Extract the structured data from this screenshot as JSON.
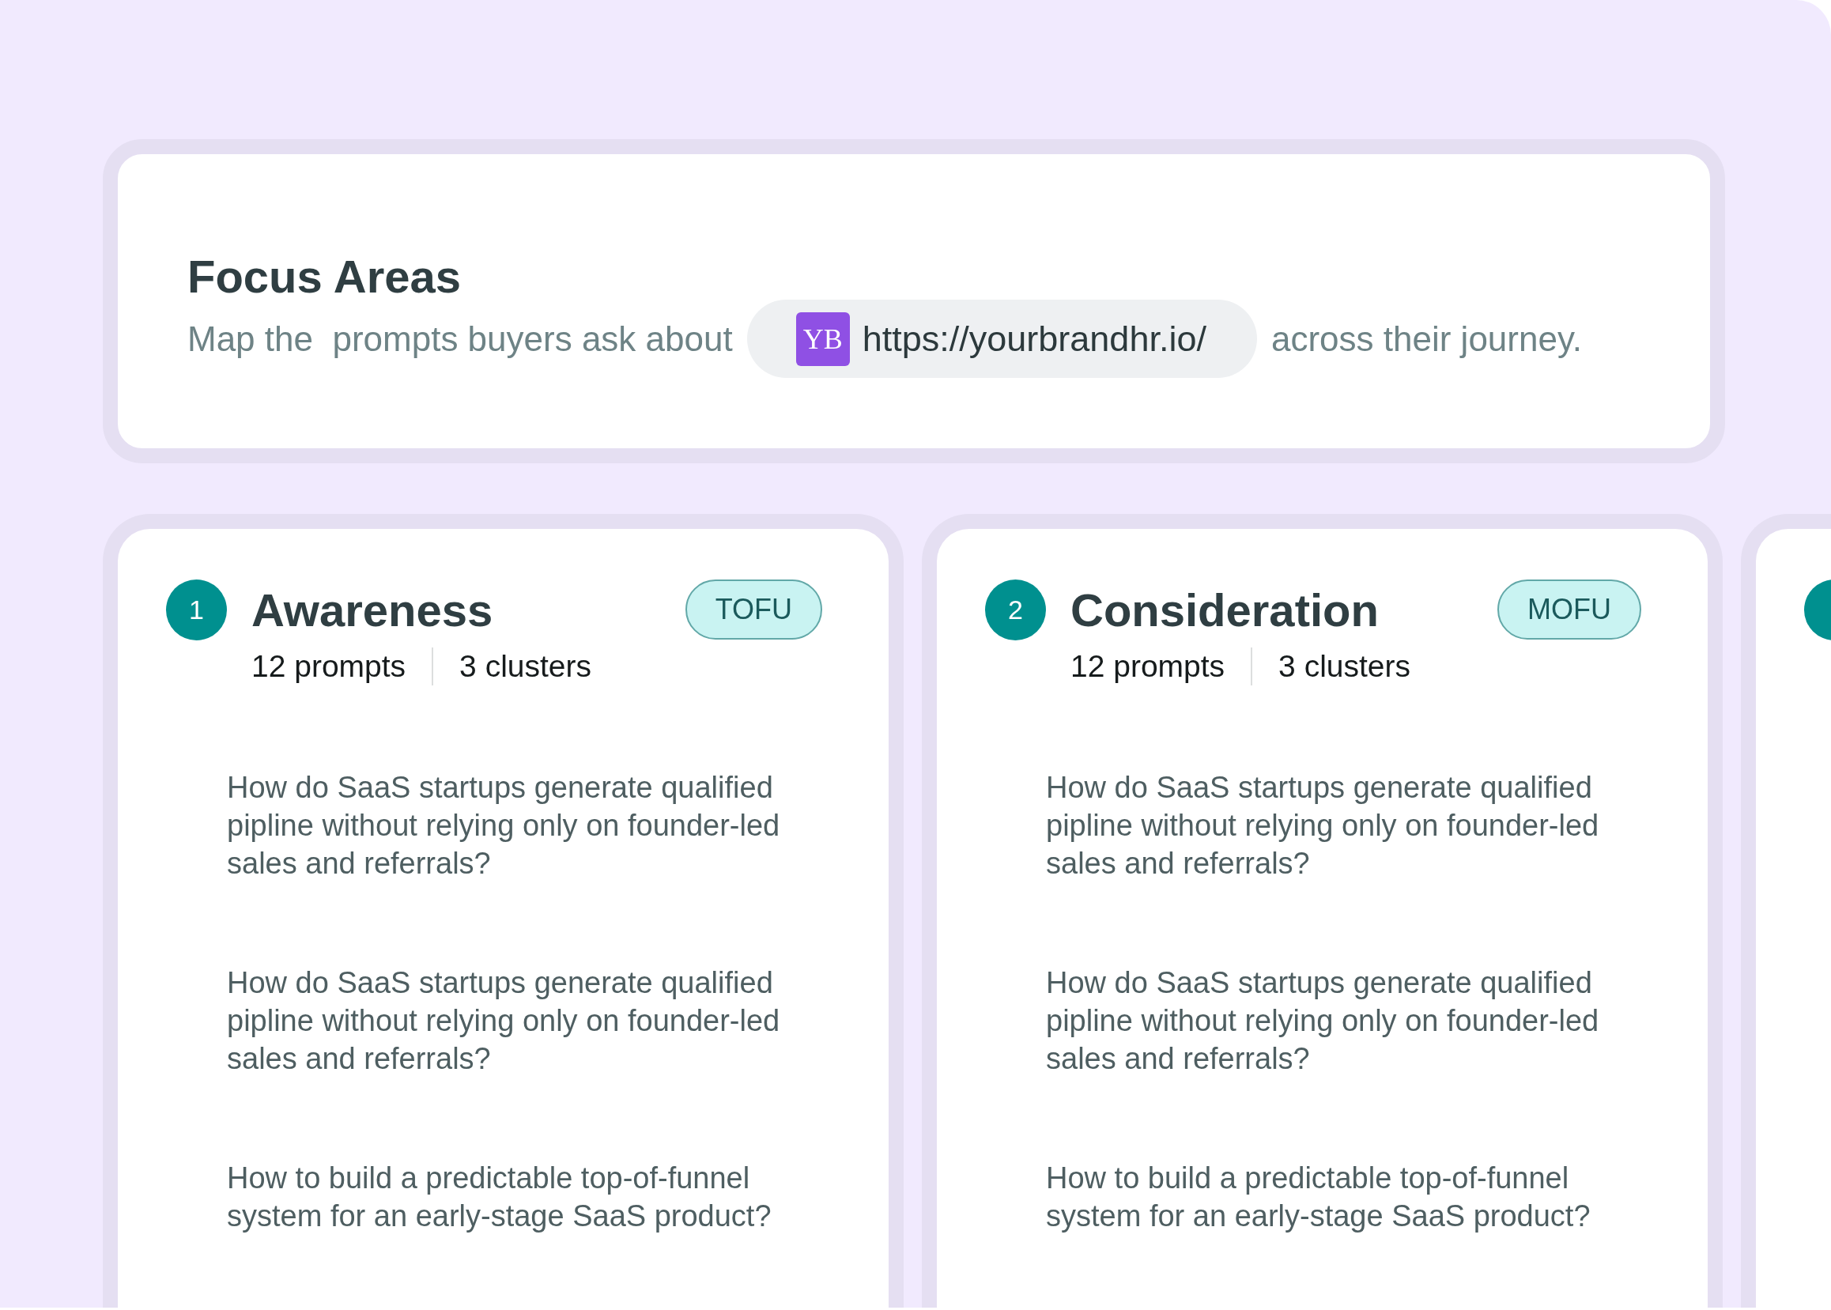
{
  "header": {
    "title": "Focus Areas",
    "subtitle_before": "Map the  prompts buyers ask about",
    "url": {
      "logo_text": "YB",
      "text": "https://yourbrandhr.io/"
    },
    "subtitle_after": "across their journey."
  },
  "stages": [
    {
      "kind": "full",
      "number": "1",
      "title": "Awareness",
      "badge": "TOFU",
      "prompts_count": "12 prompts",
      "clusters_count": "3 clusters",
      "prompts": [
        "How do SaaS startups generate qualified pipline without relying only on founder-led sales and referrals?",
        "How do SaaS startups generate qualified pipline without relying only on founder-led sales and referrals?",
        "How to build a predictable top-of-funnel system for an early-stage SaaS product?"
      ]
    },
    {
      "kind": "full",
      "number": "2",
      "title": "Consideration",
      "badge": "MOFU",
      "prompts_count": "12 prompts",
      "clusters_count": "3 clusters",
      "prompts": [
        "How do SaaS startups generate qualified pipline without relying only on founder-led sales and referrals?",
        "How do SaaS startups generate qualified pipline without relying only on founder-led sales and referrals?",
        "How to build a predictable top-of-funnel system for an early-stage SaaS product?"
      ]
    },
    {
      "kind": "cut"
    }
  ]
}
